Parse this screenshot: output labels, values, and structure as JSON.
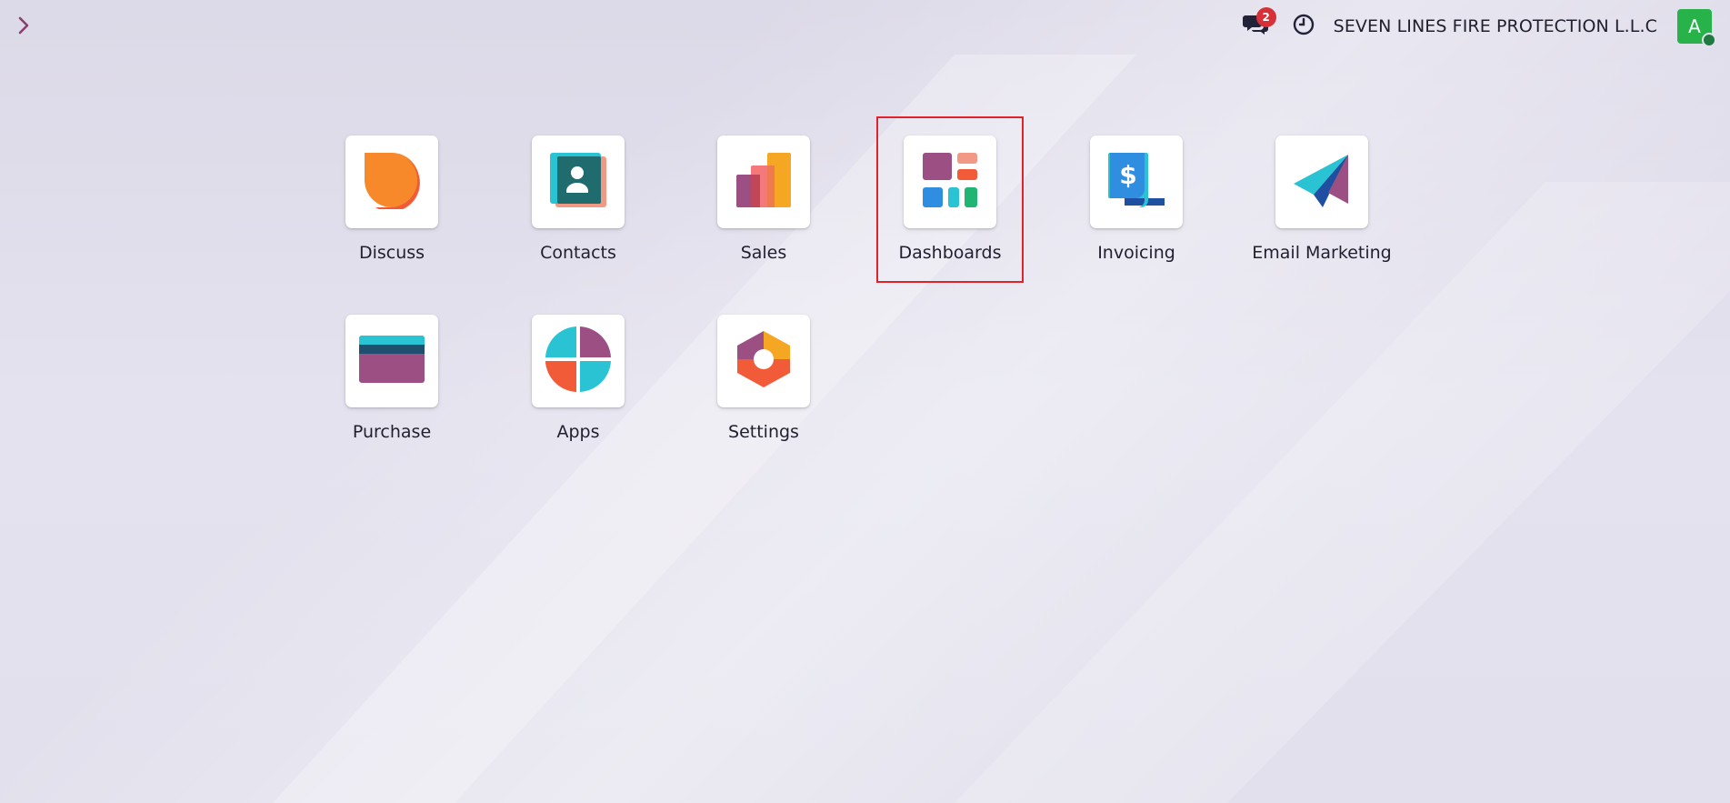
{
  "topbar": {
    "company_name": "SEVEN LINES FIRE PROTECTION L.L.C",
    "messages_badge": "2",
    "avatar_initial": "A",
    "icons": {
      "toggle": "chevron-right-icon",
      "messages": "chat-bubbles-icon",
      "activity": "clock-icon"
    }
  },
  "apps": [
    {
      "label": "Discuss",
      "icon": "discuss-icon"
    },
    {
      "label": "Contacts",
      "icon": "contacts-icon"
    },
    {
      "label": "Sales",
      "icon": "sales-icon"
    },
    {
      "label": "Dashboards",
      "icon": "dashboards-icon"
    },
    {
      "label": "Invoicing",
      "icon": "invoicing-icon"
    },
    {
      "label": "Email Marketing",
      "icon": "email-marketing-icon"
    },
    {
      "label": "Purchase",
      "icon": "purchase-icon"
    },
    {
      "label": "Apps",
      "icon": "apps-icon"
    },
    {
      "label": "Settings",
      "icon": "settings-icon"
    }
  ],
  "colors": {
    "accent_purple": "#9b4f82",
    "badge_red": "#d63038",
    "avatar_green": "#27b24a",
    "highlight_red": "#e0232b"
  }
}
